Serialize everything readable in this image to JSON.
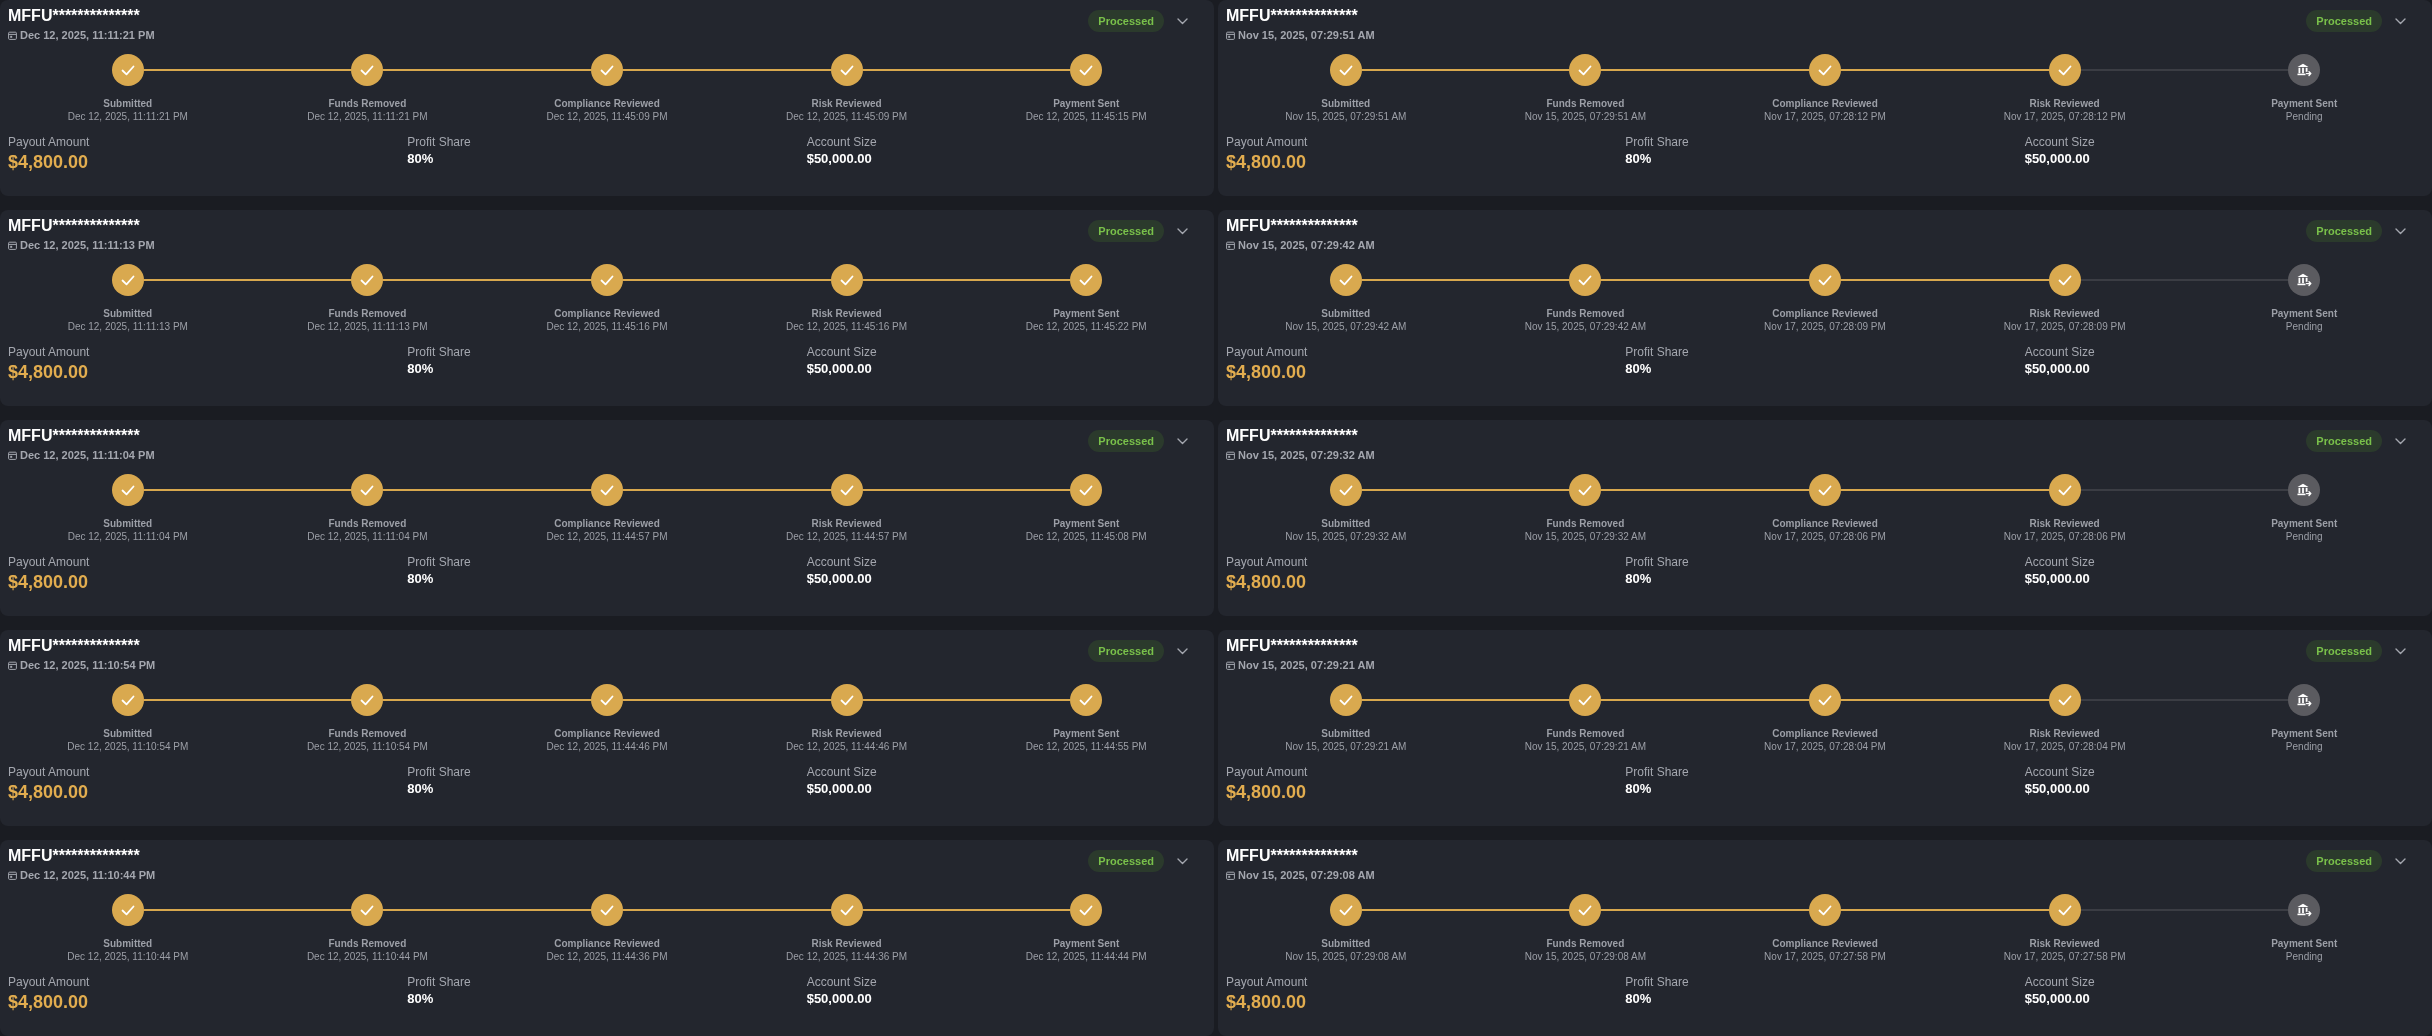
{
  "payouts": [
    {
      "account": "MFFU**************",
      "date": "Dec 12, 2025, 11:11:21 PM",
      "status": "Processed",
      "steps": [
        {
          "label": "Submitted",
          "detail": "Dec 12, 2025, 11:11:21 PM",
          "done": true
        },
        {
          "label": "Funds Removed",
          "detail": "Dec 12, 2025, 11:11:21 PM",
          "done": true
        },
        {
          "label": "Compliance Reviewed",
          "detail": "Dec 12, 2025, 11:45:09 PM",
          "done": true
        },
        {
          "label": "Risk Reviewed",
          "detail": "Dec 12, 2025, 11:45:09 PM",
          "done": true
        },
        {
          "label": "Payment Sent",
          "detail": "Dec 12, 2025, 11:45:15 PM",
          "done": true
        }
      ],
      "fields": [
        {
          "label": "Payout Amount",
          "value": "$4,800.00",
          "kind": "amount"
        },
        {
          "label": "Profit Share",
          "value": "80%",
          "kind": "plain"
        },
        {
          "label": "Account Size",
          "value": "$50,000.00",
          "kind": "plain"
        }
      ]
    },
    {
      "account": "MFFU**************",
      "date": "Nov 15, 2025, 07:29:51 AM",
      "status": "Processed",
      "steps": [
        {
          "label": "Submitted",
          "detail": "Nov 15, 2025, 07:29:51 AM",
          "done": true
        },
        {
          "label": "Funds Removed",
          "detail": "Nov 15, 2025, 07:29:51 AM",
          "done": true
        },
        {
          "label": "Compliance Reviewed",
          "detail": "Nov 17, 2025, 07:28:12 PM",
          "done": true
        },
        {
          "label": "Risk Reviewed",
          "detail": "Nov 17, 2025, 07:28:12 PM",
          "done": true
        },
        {
          "label": "Payment Sent",
          "detail": "Pending",
          "done": false
        }
      ],
      "fields": [
        {
          "label": "Payout Amount",
          "value": "$4,800.00",
          "kind": "amount"
        },
        {
          "label": "Profit Share",
          "value": "80%",
          "kind": "plain"
        },
        {
          "label": "Account Size",
          "value": "$50,000.00",
          "kind": "plain"
        }
      ]
    },
    {
      "account": "MFFU**************",
      "date": "Dec 12, 2025, 11:11:13 PM",
      "status": "Processed",
      "steps": [
        {
          "label": "Submitted",
          "detail": "Dec 12, 2025, 11:11:13 PM",
          "done": true
        },
        {
          "label": "Funds Removed",
          "detail": "Dec 12, 2025, 11:11:13 PM",
          "done": true
        },
        {
          "label": "Compliance Reviewed",
          "detail": "Dec 12, 2025, 11:45:16 PM",
          "done": true
        },
        {
          "label": "Risk Reviewed",
          "detail": "Dec 12, 2025, 11:45:16 PM",
          "done": true
        },
        {
          "label": "Payment Sent",
          "detail": "Dec 12, 2025, 11:45:22 PM",
          "done": true
        }
      ],
      "fields": [
        {
          "label": "Payout Amount",
          "value": "$4,800.00",
          "kind": "amount"
        },
        {
          "label": "Profit Share",
          "value": "80%",
          "kind": "plain"
        },
        {
          "label": "Account Size",
          "value": "$50,000.00",
          "kind": "plain"
        }
      ]
    },
    {
      "account": "MFFU**************",
      "date": "Nov 15, 2025, 07:29:42 AM",
      "status": "Processed",
      "steps": [
        {
          "label": "Submitted",
          "detail": "Nov 15, 2025, 07:29:42 AM",
          "done": true
        },
        {
          "label": "Funds Removed",
          "detail": "Nov 15, 2025, 07:29:42 AM",
          "done": true
        },
        {
          "label": "Compliance Reviewed",
          "detail": "Nov 17, 2025, 07:28:09 PM",
          "done": true
        },
        {
          "label": "Risk Reviewed",
          "detail": "Nov 17, 2025, 07:28:09 PM",
          "done": true
        },
        {
          "label": "Payment Sent",
          "detail": "Pending",
          "done": false
        }
      ],
      "fields": [
        {
          "label": "Payout Amount",
          "value": "$4,800.00",
          "kind": "amount"
        },
        {
          "label": "Profit Share",
          "value": "80%",
          "kind": "plain"
        },
        {
          "label": "Account Size",
          "value": "$50,000.00",
          "kind": "plain"
        }
      ]
    },
    {
      "account": "MFFU**************",
      "date": "Dec 12, 2025, 11:11:04 PM",
      "status": "Processed",
      "steps": [
        {
          "label": "Submitted",
          "detail": "Dec 12, 2025, 11:11:04 PM",
          "done": true
        },
        {
          "label": "Funds Removed",
          "detail": "Dec 12, 2025, 11:11:04 PM",
          "done": true
        },
        {
          "label": "Compliance Reviewed",
          "detail": "Dec 12, 2025, 11:44:57 PM",
          "done": true
        },
        {
          "label": "Risk Reviewed",
          "detail": "Dec 12, 2025, 11:44:57 PM",
          "done": true
        },
        {
          "label": "Payment Sent",
          "detail": "Dec 12, 2025, 11:45:08 PM",
          "done": true
        }
      ],
      "fields": [
        {
          "label": "Payout Amount",
          "value": "$4,800.00",
          "kind": "amount"
        },
        {
          "label": "Profit Share",
          "value": "80%",
          "kind": "plain"
        },
        {
          "label": "Account Size",
          "value": "$50,000.00",
          "kind": "plain"
        }
      ]
    },
    {
      "account": "MFFU**************",
      "date": "Nov 15, 2025, 07:29:32 AM",
      "status": "Processed",
      "steps": [
        {
          "label": "Submitted",
          "detail": "Nov 15, 2025, 07:29:32 AM",
          "done": true
        },
        {
          "label": "Funds Removed",
          "detail": "Nov 15, 2025, 07:29:32 AM",
          "done": true
        },
        {
          "label": "Compliance Reviewed",
          "detail": "Nov 17, 2025, 07:28:06 PM",
          "done": true
        },
        {
          "label": "Risk Reviewed",
          "detail": "Nov 17, 2025, 07:28:06 PM",
          "done": true
        },
        {
          "label": "Payment Sent",
          "detail": "Pending",
          "done": false
        }
      ],
      "fields": [
        {
          "label": "Payout Amount",
          "value": "$4,800.00",
          "kind": "amount"
        },
        {
          "label": "Profit Share",
          "value": "80%",
          "kind": "plain"
        },
        {
          "label": "Account Size",
          "value": "$50,000.00",
          "kind": "plain"
        }
      ]
    },
    {
      "account": "MFFU**************",
      "date": "Dec 12, 2025, 11:10:54 PM",
      "status": "Processed",
      "steps": [
        {
          "label": "Submitted",
          "detail": "Dec 12, 2025, 11:10:54 PM",
          "done": true
        },
        {
          "label": "Funds Removed",
          "detail": "Dec 12, 2025, 11:10:54 PM",
          "done": true
        },
        {
          "label": "Compliance Reviewed",
          "detail": "Dec 12, 2025, 11:44:46 PM",
          "done": true
        },
        {
          "label": "Risk Reviewed",
          "detail": "Dec 12, 2025, 11:44:46 PM",
          "done": true
        },
        {
          "label": "Payment Sent",
          "detail": "Dec 12, 2025, 11:44:55 PM",
          "done": true
        }
      ],
      "fields": [
        {
          "label": "Payout Amount",
          "value": "$4,800.00",
          "kind": "amount"
        },
        {
          "label": "Profit Share",
          "value": "80%",
          "kind": "plain"
        },
        {
          "label": "Account Size",
          "value": "$50,000.00",
          "kind": "plain"
        }
      ]
    },
    {
      "account": "MFFU**************",
      "date": "Nov 15, 2025, 07:29:21 AM",
      "status": "Processed",
      "steps": [
        {
          "label": "Submitted",
          "detail": "Nov 15, 2025, 07:29:21 AM",
          "done": true
        },
        {
          "label": "Funds Removed",
          "detail": "Nov 15, 2025, 07:29:21 AM",
          "done": true
        },
        {
          "label": "Compliance Reviewed",
          "detail": "Nov 17, 2025, 07:28:04 PM",
          "done": true
        },
        {
          "label": "Risk Reviewed",
          "detail": "Nov 17, 2025, 07:28:04 PM",
          "done": true
        },
        {
          "label": "Payment Sent",
          "detail": "Pending",
          "done": false
        }
      ],
      "fields": [
        {
          "label": "Payout Amount",
          "value": "$4,800.00",
          "kind": "amount"
        },
        {
          "label": "Profit Share",
          "value": "80%",
          "kind": "plain"
        },
        {
          "label": "Account Size",
          "value": "$50,000.00",
          "kind": "plain"
        }
      ]
    },
    {
      "account": "MFFU**************",
      "date": "Dec 12, 2025, 11:10:44 PM",
      "status": "Processed",
      "steps": [
        {
          "label": "Submitted",
          "detail": "Dec 12, 2025, 11:10:44 PM",
          "done": true
        },
        {
          "label": "Funds Removed",
          "detail": "Dec 12, 2025, 11:10:44 PM",
          "done": true
        },
        {
          "label": "Compliance Reviewed",
          "detail": "Dec 12, 2025, 11:44:36 PM",
          "done": true
        },
        {
          "label": "Risk Reviewed",
          "detail": "Dec 12, 2025, 11:44:36 PM",
          "done": true
        },
        {
          "label": "Payment Sent",
          "detail": "Dec 12, 2025, 11:44:44 PM",
          "done": true
        }
      ],
      "fields": [
        {
          "label": "Payout Amount",
          "value": "$4,800.00",
          "kind": "amount"
        },
        {
          "label": "Profit Share",
          "value": "80%",
          "kind": "plain"
        },
        {
          "label": "Account Size",
          "value": "$50,000.00",
          "kind": "plain"
        }
      ]
    },
    {
      "account": "MFFU**************",
      "date": "Nov 15, 2025, 07:29:08 AM",
      "status": "Processed",
      "steps": [
        {
          "label": "Submitted",
          "detail": "Nov 15, 2025, 07:29:08 AM",
          "done": true
        },
        {
          "label": "Funds Removed",
          "detail": "Nov 15, 2025, 07:29:08 AM",
          "done": true
        },
        {
          "label": "Compliance Reviewed",
          "detail": "Nov 17, 2025, 07:27:58 PM",
          "done": true
        },
        {
          "label": "Risk Reviewed",
          "detail": "Nov 17, 2025, 07:27:58 PM",
          "done": true
        },
        {
          "label": "Payment Sent",
          "detail": "Pending",
          "done": false
        }
      ],
      "fields": [
        {
          "label": "Payout Amount",
          "value": "$4,800.00",
          "kind": "amount"
        },
        {
          "label": "Profit Share",
          "value": "80%",
          "kind": "plain"
        },
        {
          "label": "Account Size",
          "value": "$50,000.00",
          "kind": "plain"
        }
      ]
    }
  ]
}
